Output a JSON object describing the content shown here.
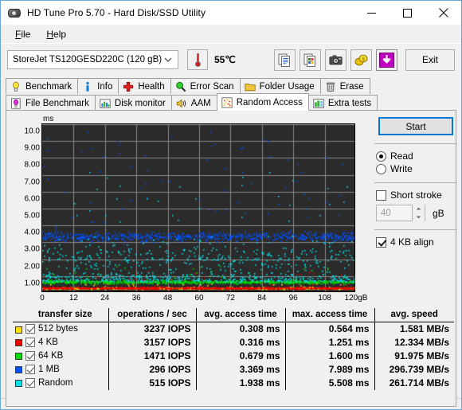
{
  "window": {
    "title": "HD Tune Pro 5.70 - Hard Disk/SSD Utility",
    "icon": "hard-disk-icon",
    "minimize": "–",
    "maximize": "□",
    "close": "✕"
  },
  "menu": {
    "items": [
      {
        "label": "File",
        "accel": "F"
      },
      {
        "label": "Help",
        "accel": "H"
      }
    ]
  },
  "toolbar": {
    "drive": "StoreJet TS120GESD220C (120 gB)",
    "temperature": "55℃",
    "buttons": [
      {
        "name": "copy-text-icon",
        "tip": "Copy text"
      },
      {
        "name": "copy-image-icon",
        "tip": "Copy image"
      },
      {
        "name": "screenshot-camera-icon",
        "tip": "Screenshot"
      },
      {
        "name": "coins-icon",
        "tip": "Donate"
      },
      {
        "name": "download-arrow-icon",
        "tip": "Download"
      }
    ],
    "exit_label": "Exit"
  },
  "tabs": {
    "row1": [
      {
        "label": "Benchmark",
        "icon": "yellow-bulb-icon",
        "active": false
      },
      {
        "label": "Info",
        "icon": "blue-info-icon",
        "active": false
      },
      {
        "label": "Health",
        "icon": "red-cross-icon",
        "active": false
      },
      {
        "label": "Error Scan",
        "icon": "green-magnifier-icon",
        "active": false
      },
      {
        "label": "Folder Usage",
        "icon": "yellow-folder-icon",
        "active": false
      },
      {
        "label": "Erase",
        "icon": "trash-can-icon",
        "active": false
      }
    ],
    "row2": [
      {
        "label": "File Benchmark",
        "icon": "magenta-bulb-page-icon",
        "active": false
      },
      {
        "label": "Disk monitor",
        "icon": "bar-chart-icon",
        "active": false
      },
      {
        "label": "AAM",
        "icon": "speaker-icon",
        "active": false
      },
      {
        "label": "Random Access",
        "icon": "scatter-dots-icon",
        "active": true
      },
      {
        "label": "Extra tests",
        "icon": "green-bar-chart-icon",
        "active": false
      }
    ]
  },
  "controls": {
    "start_label": "Start",
    "mode_read": "Read",
    "mode_write": "Write",
    "mode_selected": "Read",
    "short_stroke_label": "Short stroke",
    "short_stroke_checked": false,
    "short_stroke_value": "40",
    "short_stroke_unit": "gB",
    "align_label": "4 KB align",
    "align_checked": true
  },
  "results": {
    "headers": [
      "transfer size",
      "operations / sec",
      "avg. access time",
      "max. access time",
      "avg. speed"
    ],
    "rows": [
      {
        "color": "#ffe000",
        "label": "512 bytes",
        "checked": true,
        "iops": "3237 IOPS",
        "avg_access": "0.308 ms",
        "max_access": "0.564 ms",
        "avg_speed": "1.581 MB/s"
      },
      {
        "color": "#ee0000",
        "label": "4 KB",
        "checked": true,
        "iops": "3157 IOPS",
        "avg_access": "0.316 ms",
        "max_access": "1.251 ms",
        "avg_speed": "12.334 MB/s"
      },
      {
        "color": "#00d800",
        "label": "64 KB",
        "checked": true,
        "iops": "1471 IOPS",
        "avg_access": "0.679 ms",
        "max_access": "1.600 ms",
        "avg_speed": "91.975 MB/s"
      },
      {
        "color": "#0050ff",
        "label": "1 MB",
        "checked": true,
        "iops": "296 IOPS",
        "avg_access": "3.369 ms",
        "max_access": "7.989 ms",
        "avg_speed": "296.739 MB/s"
      },
      {
        "color": "#00e0e8",
        "label": "Random",
        "checked": true,
        "iops": "515 IOPS",
        "avg_access": "1.938 ms",
        "max_access": "5.508 ms",
        "avg_speed": "261.714 MB/s"
      }
    ]
  },
  "chart_data": {
    "type": "scatter",
    "title": "",
    "xlabel": "",
    "ylabel": "ms",
    "xlim": [
      0,
      120
    ],
    "ylim": [
      0,
      10
    ],
    "xticks": [
      0,
      12,
      24,
      36,
      48,
      60,
      72,
      84,
      96,
      108,
      120
    ],
    "xticklabels": [
      "0",
      "12",
      "24",
      "36",
      "48",
      "60",
      "72",
      "84",
      "96",
      "108",
      "120gB"
    ],
    "yticks": [
      1,
      2,
      3,
      4,
      5,
      6,
      7,
      8,
      9,
      10
    ],
    "yticklabels": [
      "1.00",
      "2.00",
      "3.00",
      "4.00",
      "5.00",
      "6.00",
      "7.00",
      "8.00",
      "9.00",
      "10.0"
    ],
    "grid": true,
    "background": "#2b2b2b",
    "gridcolor": "#8a8a8a",
    "series": [
      {
        "name": "512 bytes",
        "color": "#ffe000",
        "center_ms": 0.308,
        "spread_ms": 0.05,
        "n": 900,
        "outlier_max_ms": 0.564
      },
      {
        "name": "4 KB",
        "color": "#ee0000",
        "center_ms": 0.316,
        "spread_ms": 0.06,
        "n": 900,
        "outlier_max_ms": 1.251
      },
      {
        "name": "64 KB",
        "color": "#00d800",
        "center_ms": 0.679,
        "spread_ms": 0.1,
        "n": 850,
        "outlier_max_ms": 1.6
      },
      {
        "name": "1 MB",
        "color": "#0050ff",
        "center_ms": 3.369,
        "spread_ms": 0.3,
        "n": 700,
        "outlier_max_ms": 7.989
      },
      {
        "name": "Random",
        "color": "#00e0e8",
        "center_ms": 1.938,
        "spread_ms": 1.1,
        "n": 800,
        "outlier_max_ms": 5.508
      }
    ]
  }
}
